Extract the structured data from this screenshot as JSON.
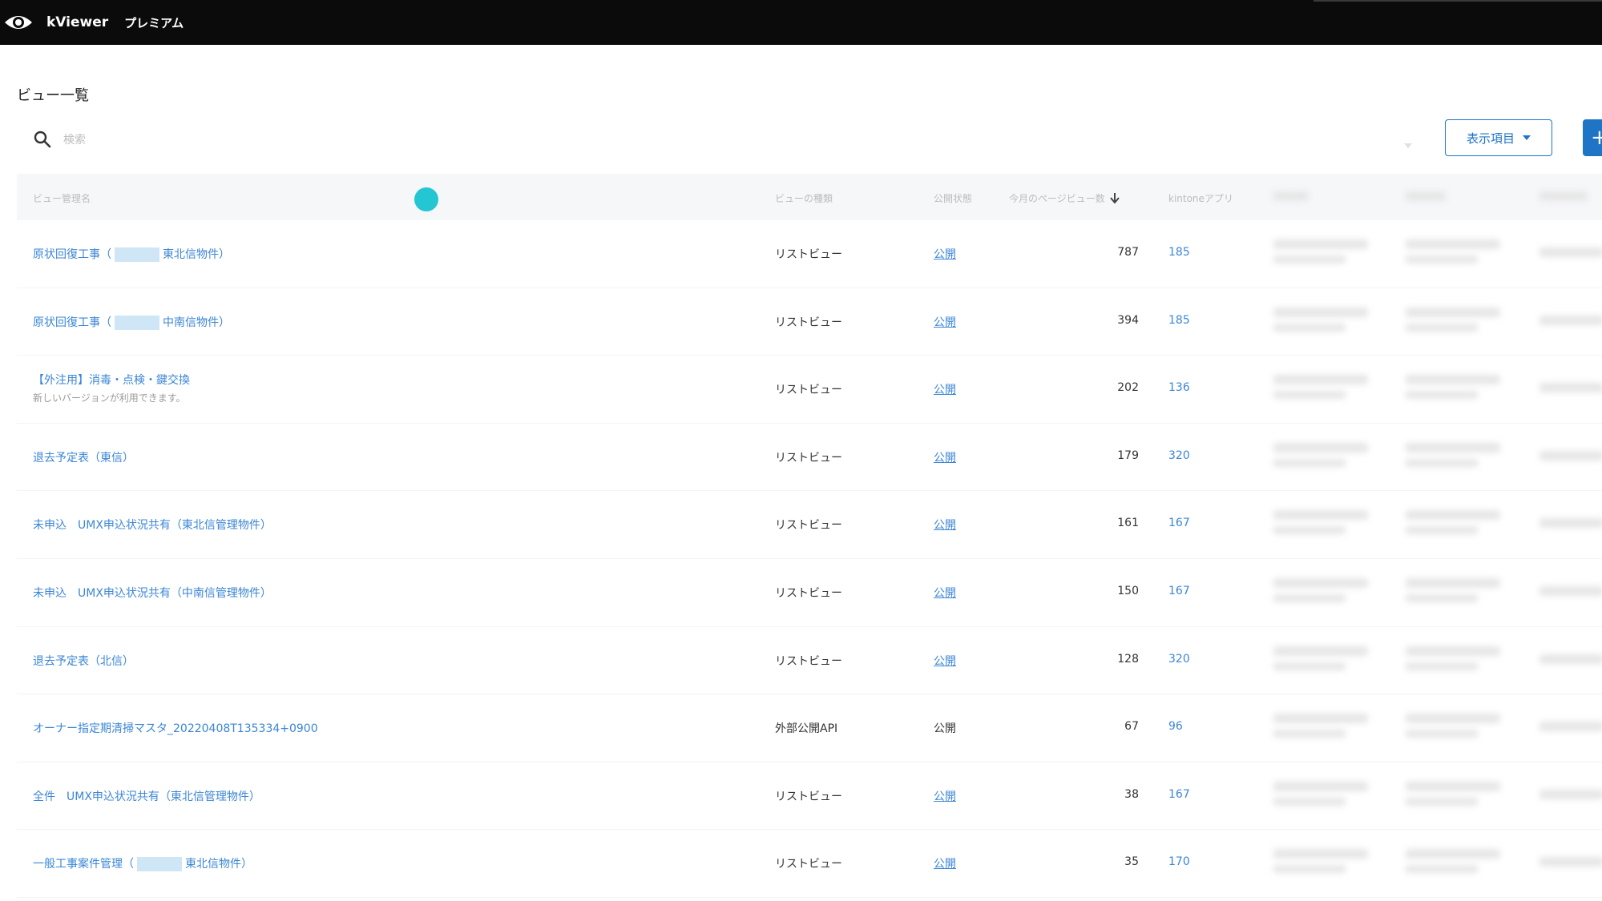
{
  "app": {
    "brand": "kViewer",
    "plan": "プレミアム"
  },
  "page": {
    "title": "ビュー一覧"
  },
  "search": {
    "placeholder": "検索",
    "filter_placeholder": ""
  },
  "toolbar": {
    "columns_label": "表示項目",
    "add_label": "+"
  },
  "table": {
    "headers": {
      "name": "ビュー管理名",
      "type": "ビューの種類",
      "status": "公開状態",
      "views": "今月のページビュー数",
      "app": "kintoneアプリ"
    },
    "rows": [
      {
        "name_pre": "原状回復工事（",
        "name_post": "東北信物件）",
        "redacted": true,
        "sub": "",
        "type": "リストビュー",
        "status": "公開",
        "status_link": true,
        "views": "787",
        "app": "185"
      },
      {
        "name_pre": "原状回復工事（",
        "name_post": "中南信物件）",
        "redacted": true,
        "sub": "",
        "type": "リストビュー",
        "status": "公開",
        "status_link": true,
        "views": "394",
        "app": "185"
      },
      {
        "name_pre": "【外注用】消毒・点検・鍵交換",
        "name_post": "",
        "redacted": false,
        "sub": "新しいバージョンが利用できます。",
        "type": "リストビュー",
        "status": "公開",
        "status_link": true,
        "views": "202",
        "app": "136"
      },
      {
        "name_pre": "退去予定表（東信）",
        "name_post": "",
        "redacted": false,
        "sub": "",
        "type": "リストビュー",
        "status": "公開",
        "status_link": true,
        "views": "179",
        "app": "320"
      },
      {
        "name_pre": "未申込　UMX申込状況共有（東北信管理物件）",
        "name_post": "",
        "redacted": false,
        "sub": "",
        "type": "リストビュー",
        "status": "公開",
        "status_link": true,
        "views": "161",
        "app": "167"
      },
      {
        "name_pre": "未申込　UMX申込状況共有（中南信管理物件）",
        "name_post": "",
        "redacted": false,
        "sub": "",
        "type": "リストビュー",
        "status": "公開",
        "status_link": true,
        "views": "150",
        "app": "167"
      },
      {
        "name_pre": "退去予定表（北信）",
        "name_post": "",
        "redacted": false,
        "sub": "",
        "type": "リストビュー",
        "status": "公開",
        "status_link": true,
        "views": "128",
        "app": "320"
      },
      {
        "name_pre": "オーナー指定期清掃マスタ_20220408T135334+0900",
        "name_post": "",
        "redacted": false,
        "sub": "",
        "type": "外部公開API",
        "status": "公開",
        "status_link": false,
        "views": "67",
        "app": "96"
      },
      {
        "name_pre": "全件　UMX申込状況共有（東北信管理物件）",
        "name_post": "",
        "redacted": false,
        "sub": "",
        "type": "リストビュー",
        "status": "公開",
        "status_link": true,
        "views": "38",
        "app": "167"
      },
      {
        "name_pre": "一般工事案件管理（",
        "name_post": "東北信物件）",
        "redacted": true,
        "sub": "",
        "type": "リストビュー",
        "status": "公開",
        "status_link": true,
        "views": "35",
        "app": "170"
      }
    ]
  }
}
